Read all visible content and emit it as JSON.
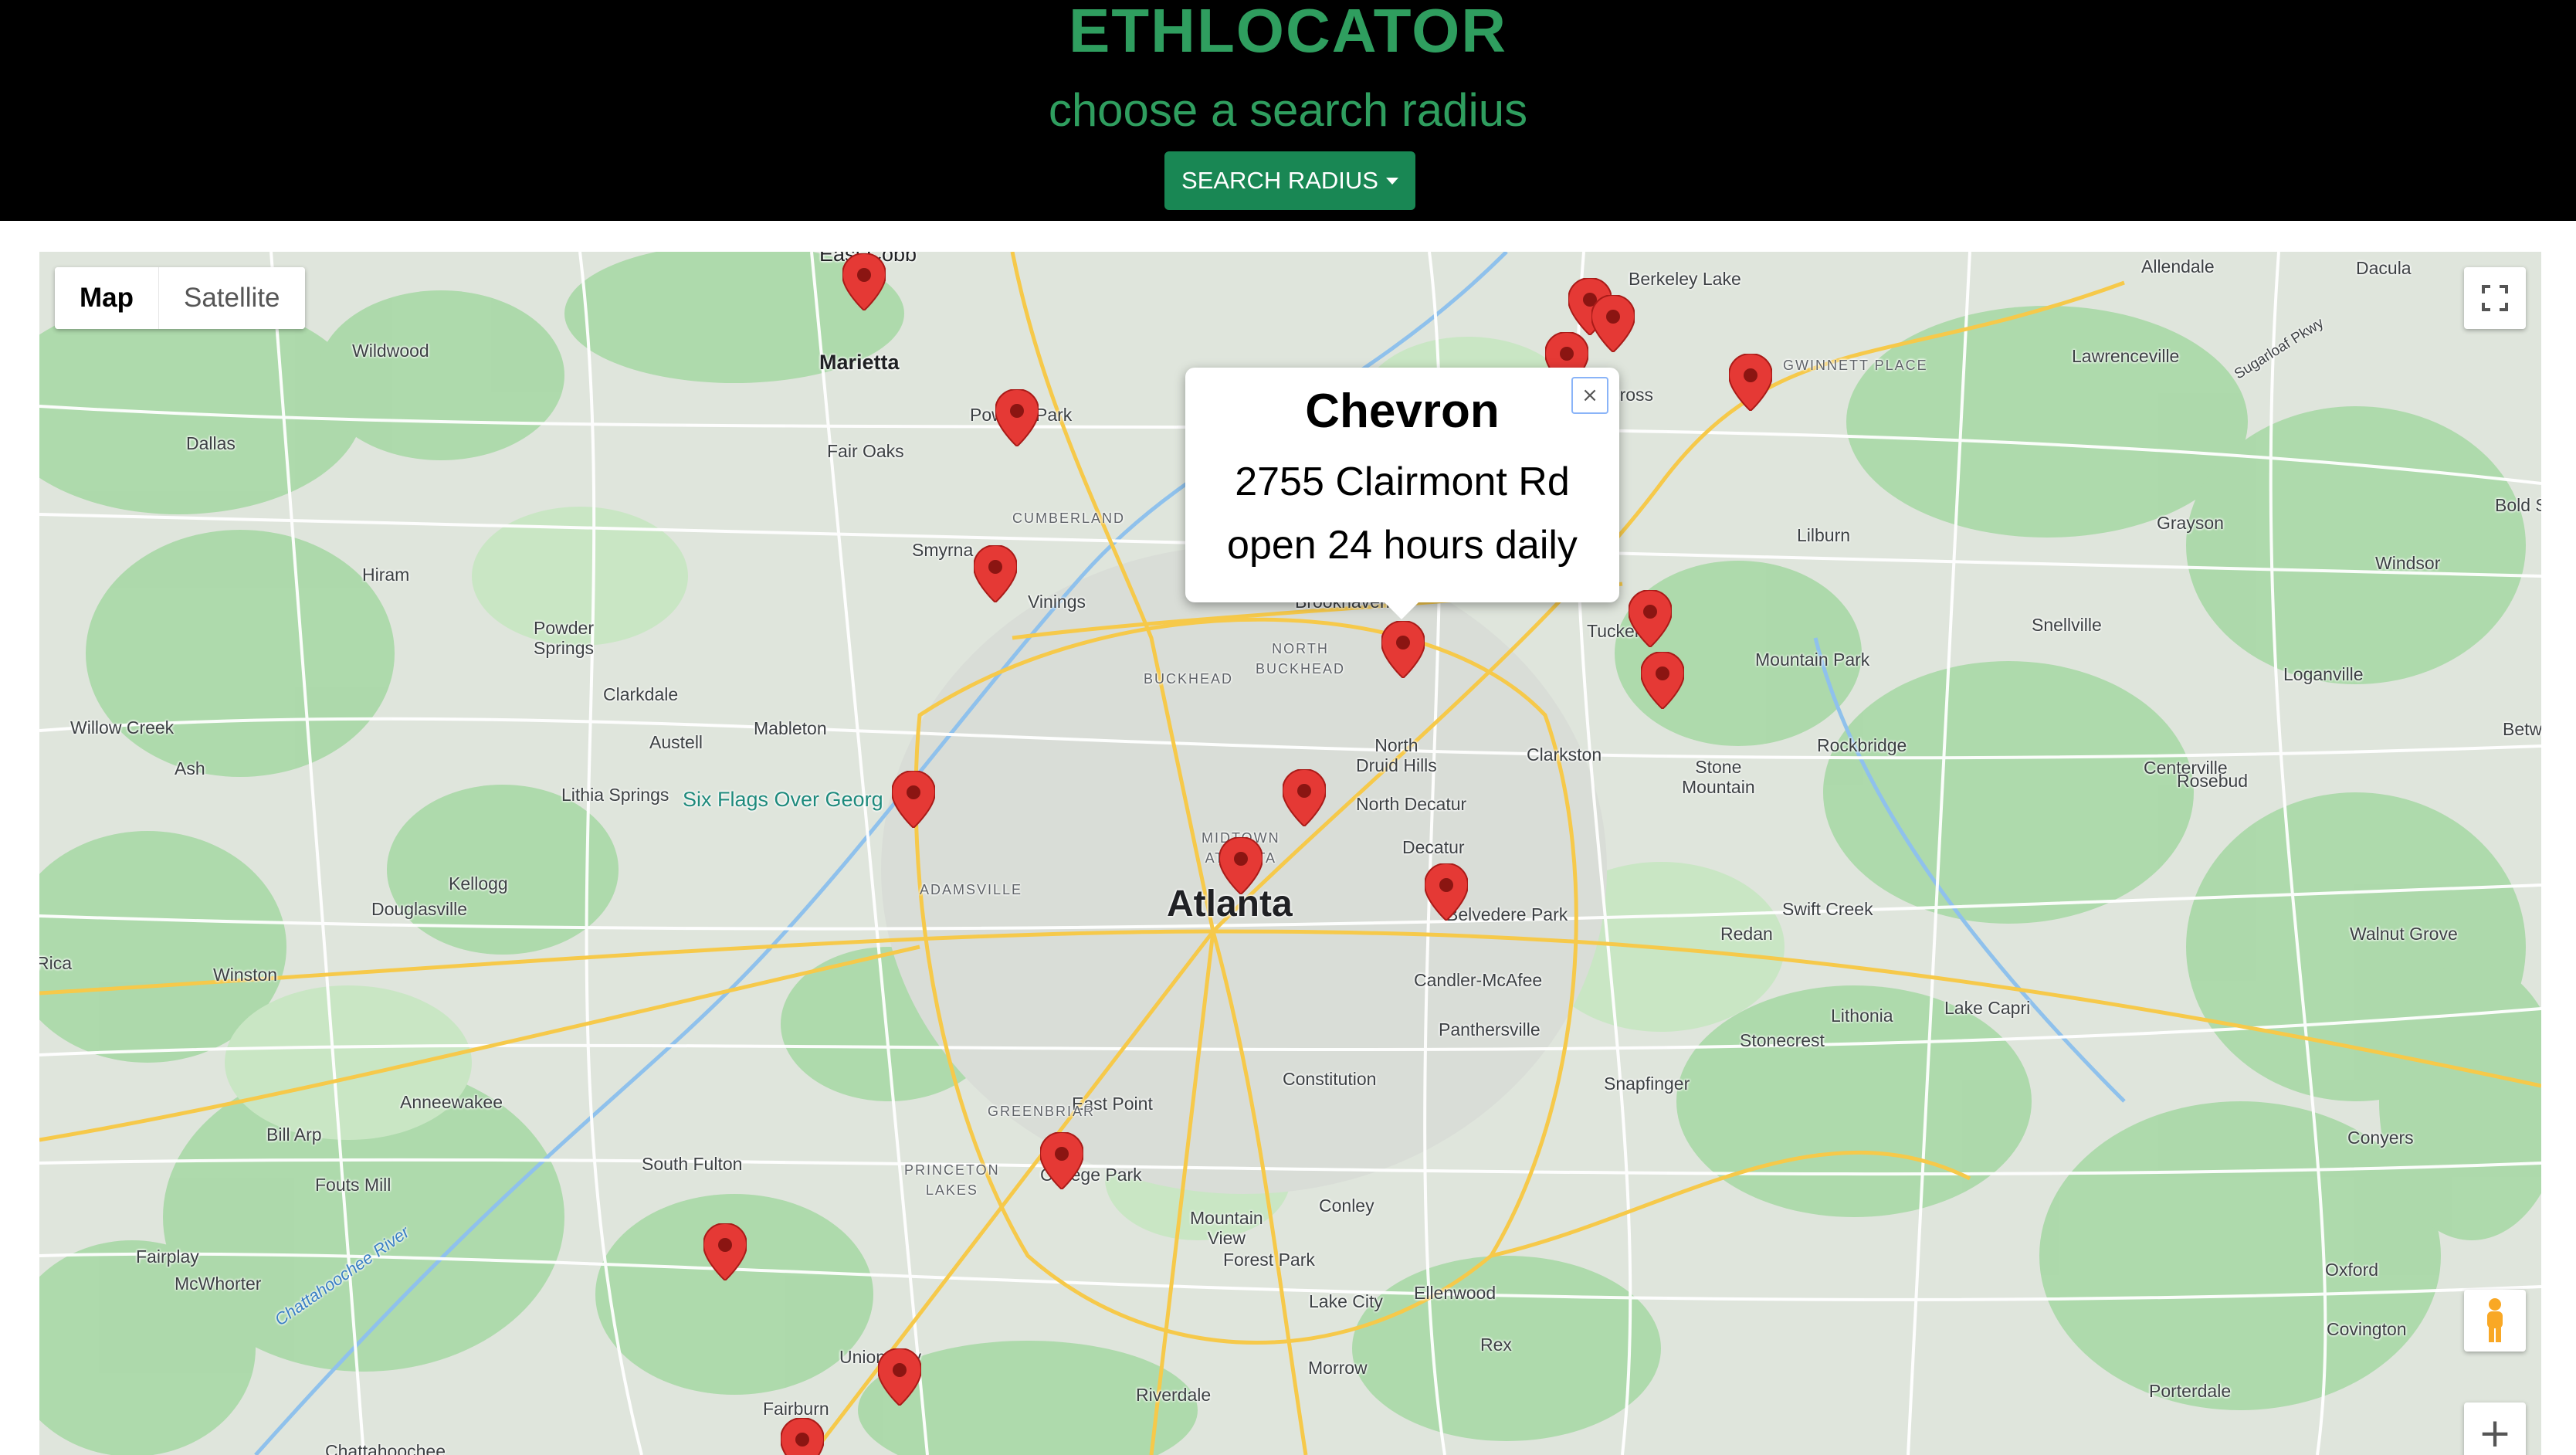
{
  "header": {
    "title": "ETHLOCATOR",
    "subtitle": "choose a search radius",
    "radius_button_label": "SEARCH RADIUS"
  },
  "map": {
    "type_controls": {
      "map_label": "Map",
      "satellite_label": "Satellite",
      "selected": "Map"
    },
    "info_window": {
      "name": "Chevron",
      "address": "2755 Clairmont Rd",
      "hours": "open 24 hours daily",
      "close_glyph": "×"
    },
    "zoom_in_glyph": "+",
    "icons": {
      "fullscreen": "fullscreen-icon",
      "pegman": "pegman-icon",
      "marker": "map-pin-icon",
      "zoom_in": "zoom-in-icon",
      "close": "close-icon"
    },
    "marker_color": "#e53935",
    "place_labels": {
      "atlanta": "Atlanta",
      "marietta": "Marietta",
      "east_cobb": "East Cobb",
      "wildwood": "Wildwood",
      "dallas": "Dallas",
      "fair_oaks": "Fair Oaks",
      "powder_springs": "Powder\nSprings",
      "hiram": "Hiram",
      "smyrna": "Smyrna",
      "vinings": "Vinings",
      "cumberland": "CUMBERLAND",
      "clarkdale": "Clarkdale",
      "willow_creek": "Willow Creek",
      "ash": "Ash",
      "austell": "Austell",
      "mableton": "Mableton",
      "lithia_springs": "Lithia Springs",
      "six_flags": "Six Flags Over Georg",
      "kellogg": "Kellogg",
      "douglasville": "Douglasville",
      "rica": "Rica",
      "winston": "Winston",
      "anneewakee": "Anneewakee",
      "bill_arp": "Bill Arp",
      "fouts_mill": "Fouts Mill",
      "south_fulton": "South Fulton",
      "fairplay": "Fairplay",
      "mcwhorter": "McWhorter",
      "chattahoochee_river": "Chattahoochee River",
      "chattahoochee": "Chattahoochee",
      "union_city": "Union City",
      "fairburn": "Fairburn",
      "adamsville": "ADAMSVILLE",
      "buckhead": "BUCKHEAD",
      "north_buckhead": "NORTH\nBUCKHEAD",
      "brookhaven": "Brookhaven",
      "midtown": "MIDTOWN\nATLANTA",
      "north_druid_hills": "North\nDruid Hills",
      "north_decatur": "North Decatur",
      "decatur": "Decatur",
      "belvedere_park": "Belvedere Park",
      "clarkston": "Clarkston",
      "tucker": "Tucker",
      "stone_mountain": "Stone\nMountain",
      "mountain_park": "Mountain Park",
      "rockbridge": "Rockbridge",
      "centerville": "Centerville",
      "rosebud": "Rosebud",
      "candler_mcafee": "Candler-McAfee",
      "panthersville": "Panthersville",
      "constitution": "Constitution",
      "snapfinger": "Snapfinger",
      "redan": "Redan",
      "swift_creek": "Swift Creek",
      "lithonia": "Lithonia",
      "stonecrest": "Stonecrest",
      "lake_capri": "Lake Capri",
      "conyers": "Conyers",
      "walnut_grove": "Walnut Grove",
      "east_point": "East Point",
      "greenbriar": "GREENBRIAR",
      "princeton_lakes": "PRINCETON\nLAKES",
      "college_park": "College Park",
      "mountain_view": "Mountain\nView",
      "conley": "Conley",
      "forest_park": "Forest Park",
      "lake_city": "Lake City",
      "ellenwood": "Ellenwood",
      "rex": "Rex",
      "morrow": "Morrow",
      "riverdale": "Riverdale",
      "berkeley_lake": "Berkeley Lake",
      "allendale": "Allendale",
      "dacula": "Dacula",
      "lawrenceville": "Lawrenceville",
      "gwinnett_place": "GWINNETT PLACE",
      "cross": "Cross",
      "lilburn": "Lilburn",
      "grayson": "Grayson",
      "bold_s": "Bold S",
      "windsor": "Windsor",
      "snellville": "Snellville",
      "loganville": "Loganville",
      "betw": "Betw",
      "oxford": "Oxford",
      "covington": "Covington",
      "porterdale": "Porterdale",
      "sugarloaf_pkwy": "Sugarloaf Pkwy",
      "pow_park": "Pow",
      "park": "Park"
    }
  }
}
